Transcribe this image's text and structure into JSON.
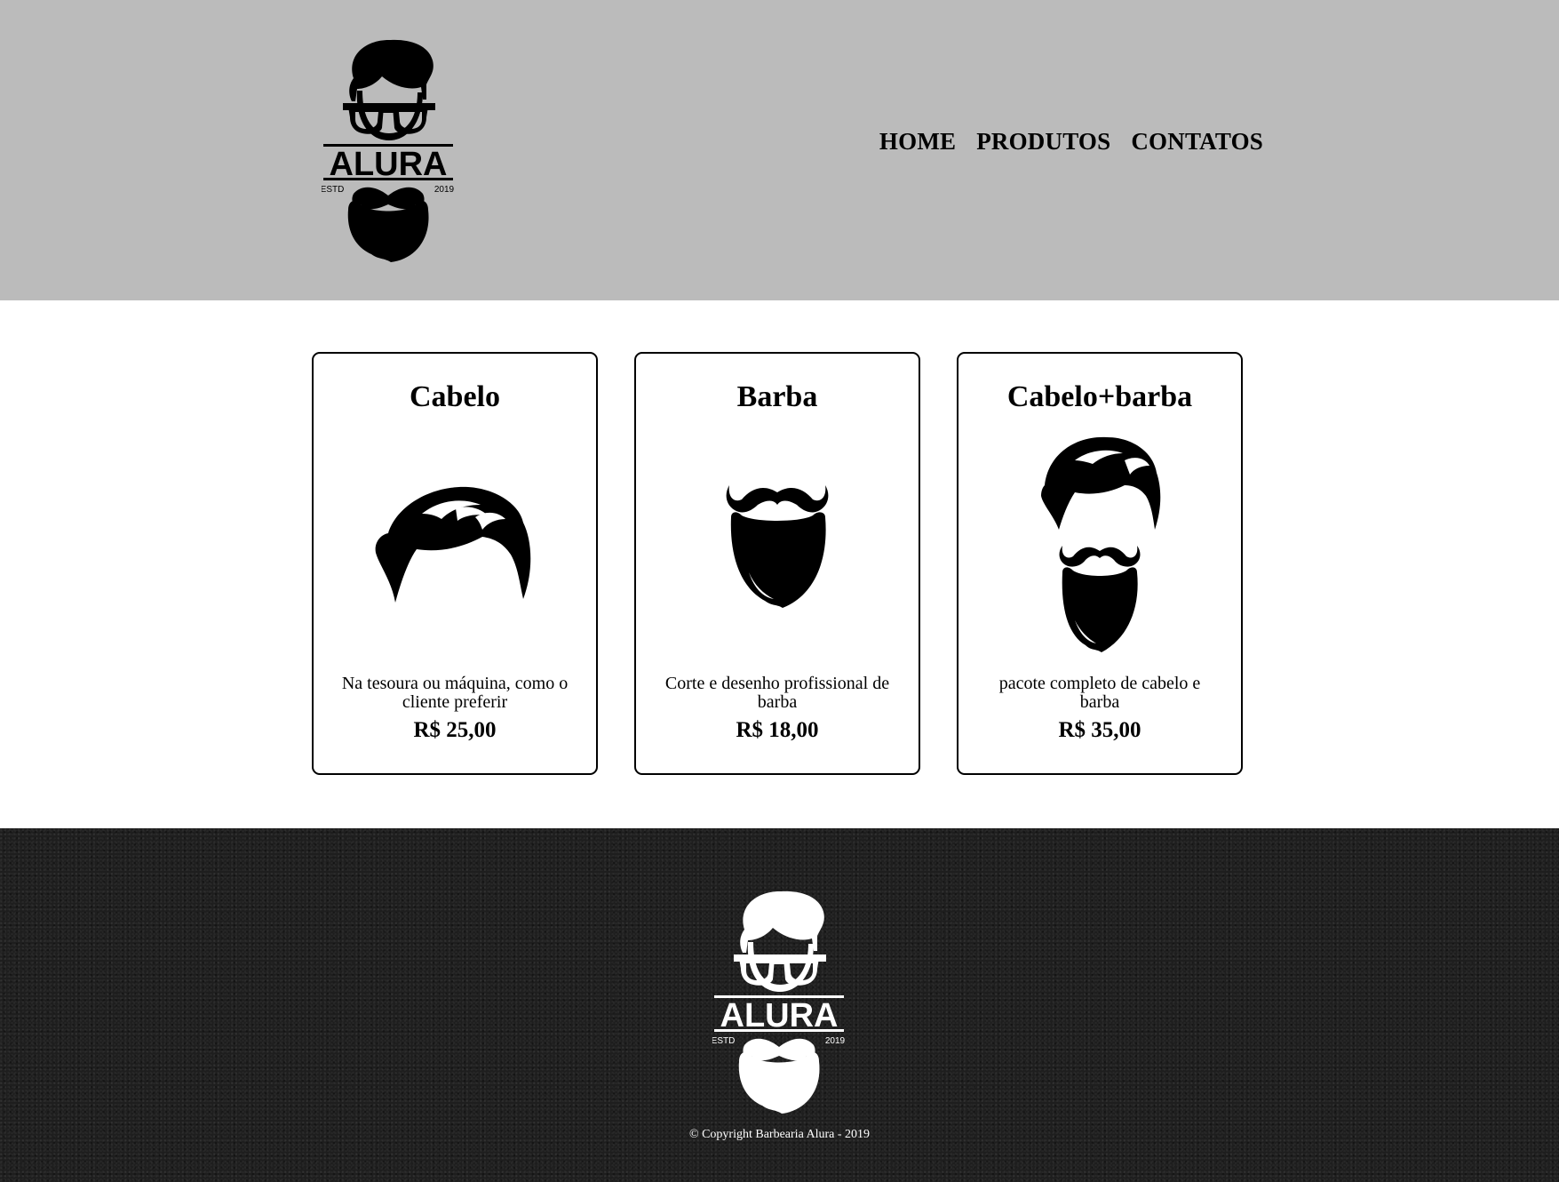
{
  "header": {
    "logo": {
      "brand_text": "ALURA",
      "left_text": "ESTD",
      "right_text": "2019"
    },
    "nav": [
      "HOME",
      "PRODUTOS",
      "CONTATOS"
    ]
  },
  "products": [
    {
      "title": "Cabelo",
      "description": "Na tesoura ou máquina, como o cliente preferir",
      "price": "R$ 25,00",
      "icon": "hair-icon"
    },
    {
      "title": "Barba",
      "description": "Corte e desenho profissional de barba",
      "price": "R$ 18,00",
      "icon": "beard-icon"
    },
    {
      "title": "Cabelo+barba",
      "description": "pacote completo de cabelo e barba",
      "price": "R$ 35,00",
      "icon": "hair-beard-icon"
    }
  ],
  "footer": {
    "logo": {
      "brand_text": "ALURA",
      "left_text": "ESTD",
      "right_text": "2019"
    },
    "copyright": "© Copyright Barbearia Alura - 2019"
  },
  "colors": {
    "header_bg": "#bbbbbb",
    "footer_bg": "#1e1e1e"
  }
}
